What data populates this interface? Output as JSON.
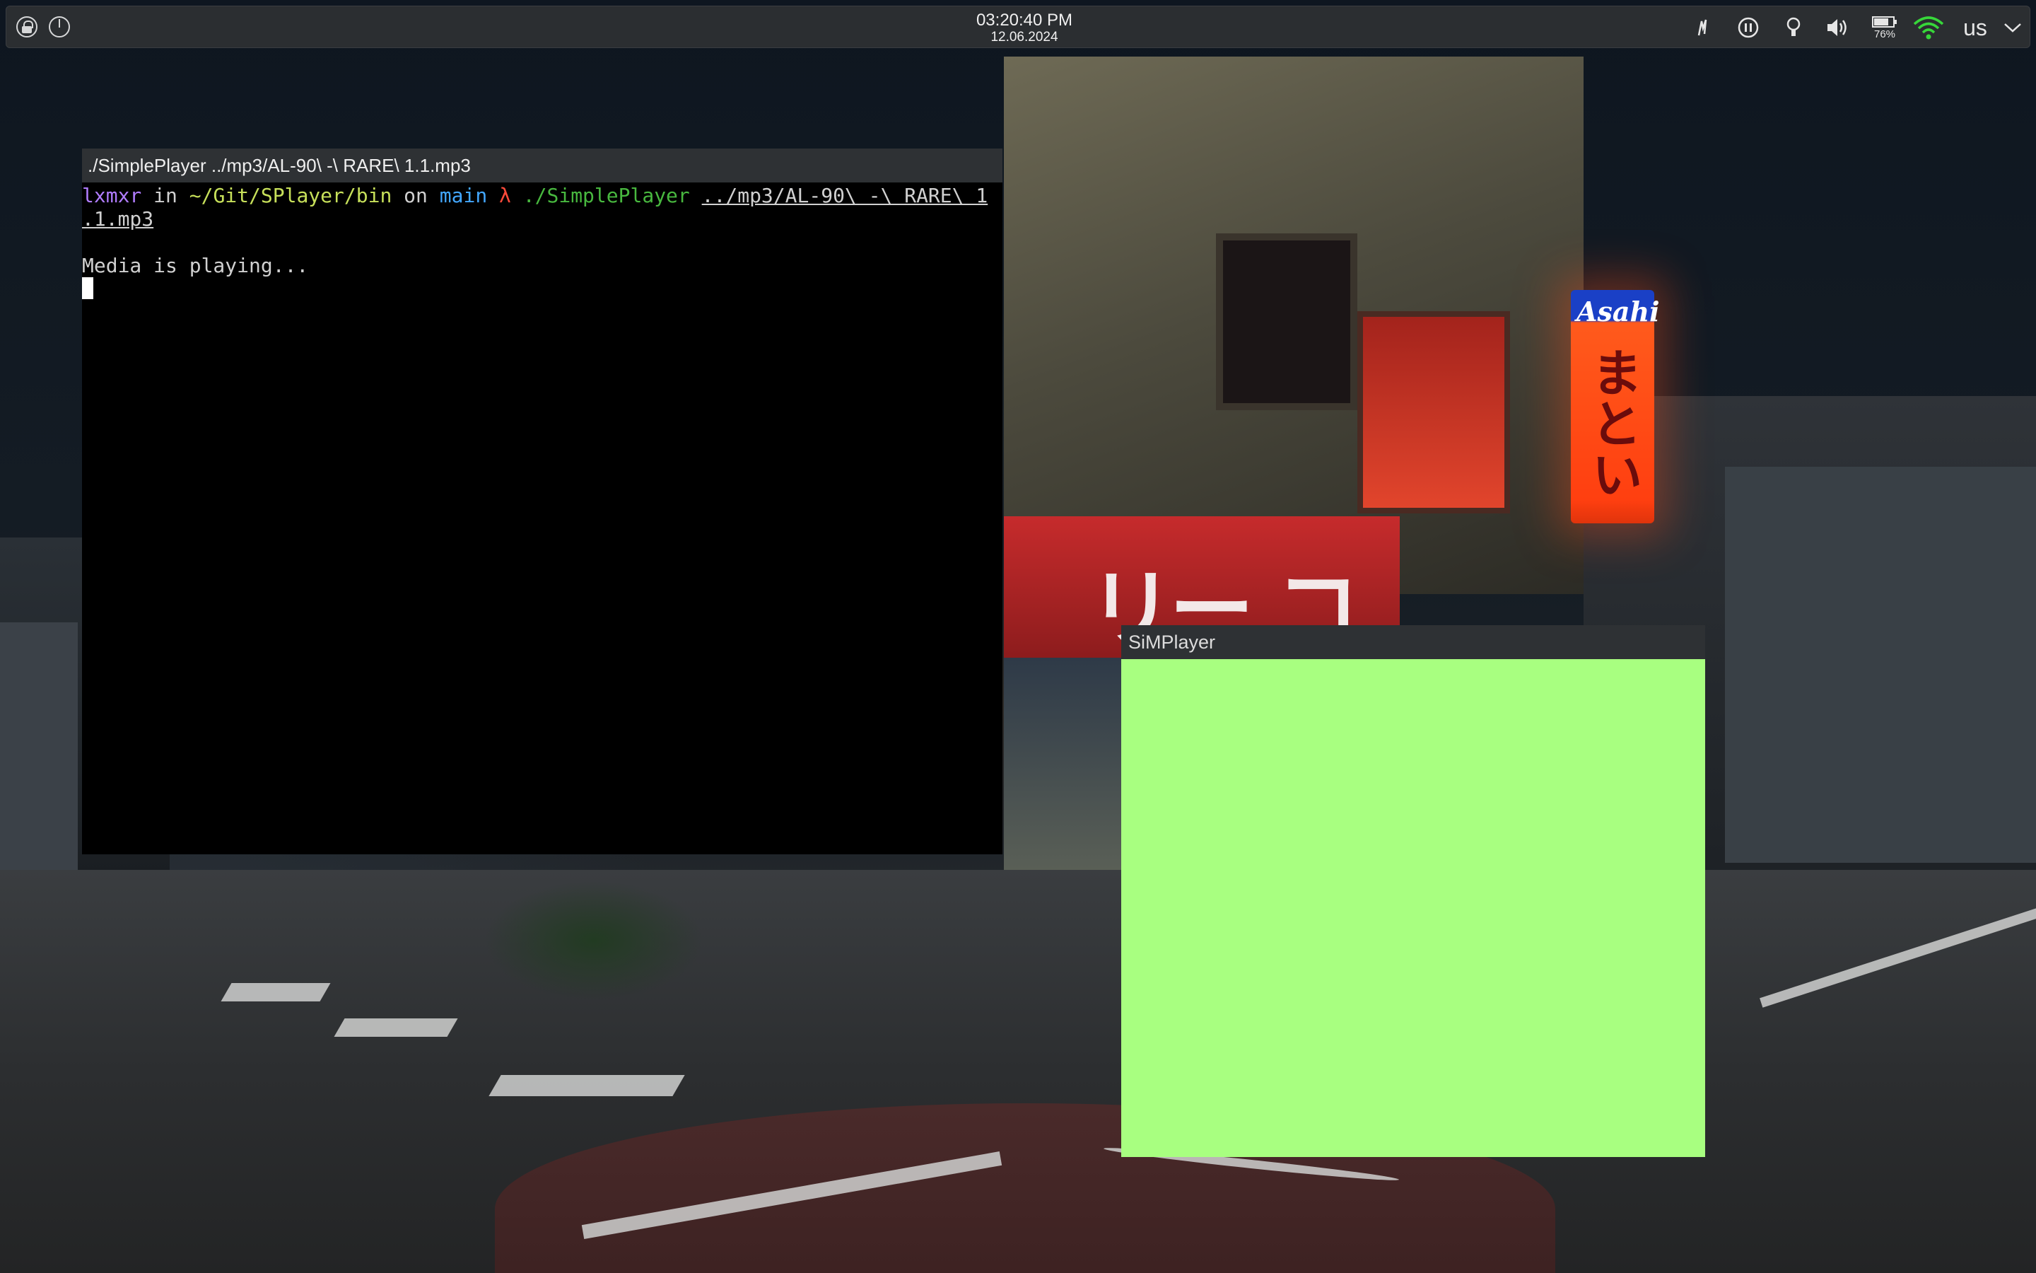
{
  "panel": {
    "time": "03:20:40 PM",
    "date": "12.06.2024",
    "battery_percent": "76%",
    "keyboard_layout": "us",
    "left_icons": [
      "lock-icon",
      "power-icon"
    ],
    "tray_icons": [
      "kdeconnect-icon",
      "media-pause-icon",
      "notifications-icon",
      "volume-icon",
      "battery-icon",
      "wifi-icon",
      "keyboard-layout",
      "expand-tray-icon"
    ]
  },
  "wallpaper": {
    "sign_brand": "Asahi",
    "sign_text": "まとい",
    "store_text": "リー コインランドリー"
  },
  "terminal": {
    "title": "./SimplePlayer ../mp3/AL-90\\ -\\ RARE\\ 1.1.mp3",
    "user": "lxmxr",
    "in_word": " in ",
    "path": "~/Git/SPlayer/bin",
    "on_word": " on ",
    "branch": "main",
    "lambda": " λ ",
    "command": "./SimplePlayer",
    "arg_line1": "../mp3/AL-90\\ -\\ RARE\\ 1",
    "arg_line2": ".1.mp3",
    "output": "Media is playing..."
  },
  "player": {
    "title": "SiMPlayer",
    "canvas_color": "#a8ff80"
  },
  "colors": {
    "panel_bg": "#2b2e31",
    "titlebar_bg": "#2e3134",
    "prompt_user": "#b07cff",
    "prompt_path": "#c7e05a",
    "prompt_branch": "#43a7ff",
    "prompt_lambda": "#ff4a3a",
    "prompt_command": "#48b83f"
  }
}
